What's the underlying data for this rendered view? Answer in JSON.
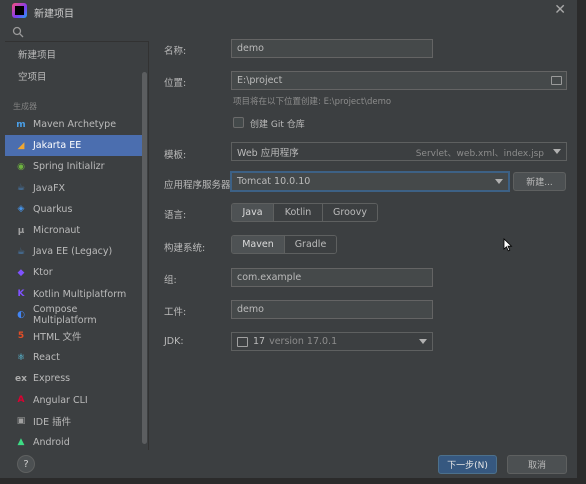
{
  "window": {
    "title": "新建项目"
  },
  "sidebar": {
    "top_items": [
      "新建项目",
      "空项目"
    ],
    "section_label": "生成器",
    "generators": [
      {
        "label": "Maven Archetype",
        "icon": "m-icon",
        "color": "#4a9fe8"
      },
      {
        "label": "Jakarta EE",
        "icon": "jakarta-icon",
        "color": "#f0a732"
      },
      {
        "label": "Spring Initializr",
        "icon": "spring-icon",
        "color": "#6db33f"
      },
      {
        "label": "JavaFX",
        "icon": "javafx-icon",
        "color": "#4a88c7"
      },
      {
        "label": "Quarkus",
        "icon": "quarkus-icon",
        "color": "#4695eb"
      },
      {
        "label": "Micronaut",
        "icon": "micronaut-icon",
        "color": "#a0a0a0"
      },
      {
        "label": "Java EE (Legacy)",
        "icon": "javaee-icon",
        "color": "#4a88c7"
      },
      {
        "label": "Ktor",
        "icon": "ktor-icon",
        "color": "#7f52ff"
      },
      {
        "label": "Kotlin Multiplatform",
        "icon": "kotlin-icon",
        "color": "#7f52ff"
      },
      {
        "label": "Compose Multiplatform",
        "icon": "compose-icon",
        "color": "#4285f4"
      },
      {
        "label": "HTML 文件",
        "icon": "html-icon",
        "color": "#e44d26"
      },
      {
        "label": "React",
        "icon": "react-icon",
        "color": "#61dafb"
      },
      {
        "label": "Express",
        "icon": "express-icon",
        "color": "#aaaaaa"
      },
      {
        "label": "Angular CLI",
        "icon": "angular-icon",
        "color": "#dd0031"
      },
      {
        "label": "IDE 插件",
        "icon": "plugin-icon",
        "color": "#a0a0a0"
      },
      {
        "label": "Android",
        "icon": "android-icon",
        "color": "#3ddc84"
      }
    ],
    "selected_index": 1
  },
  "form": {
    "name_label": "名称:",
    "name_value": "demo",
    "location_label": "位置:",
    "location_value": "E:\\project",
    "location_hint": "项目将在以下位置创建: E:\\project\\demo",
    "git_label": "创建 Git 仓库",
    "template_label": "模板:",
    "template_value": "Web 应用程序",
    "template_detail": "Servlet、web.xml、index.jsp",
    "server_label": "应用程序服务器:",
    "server_value": "Tomcat 10.0.10",
    "new_button": "新建...",
    "language_label": "语言:",
    "languages": [
      "Java",
      "Kotlin",
      "Groovy"
    ],
    "build_label": "构建系统:",
    "builds": [
      "Maven",
      "Gradle"
    ],
    "group_label": "组:",
    "group_value": "com.example",
    "artifact_label": "工件:",
    "artifact_value": "demo",
    "jdk_label": "JDK:",
    "jdk_number": "17",
    "jdk_version": "version 17.0.1"
  },
  "footer": {
    "help_label": "?",
    "next_label": "下一步(N)",
    "cancel_label": "取消"
  }
}
